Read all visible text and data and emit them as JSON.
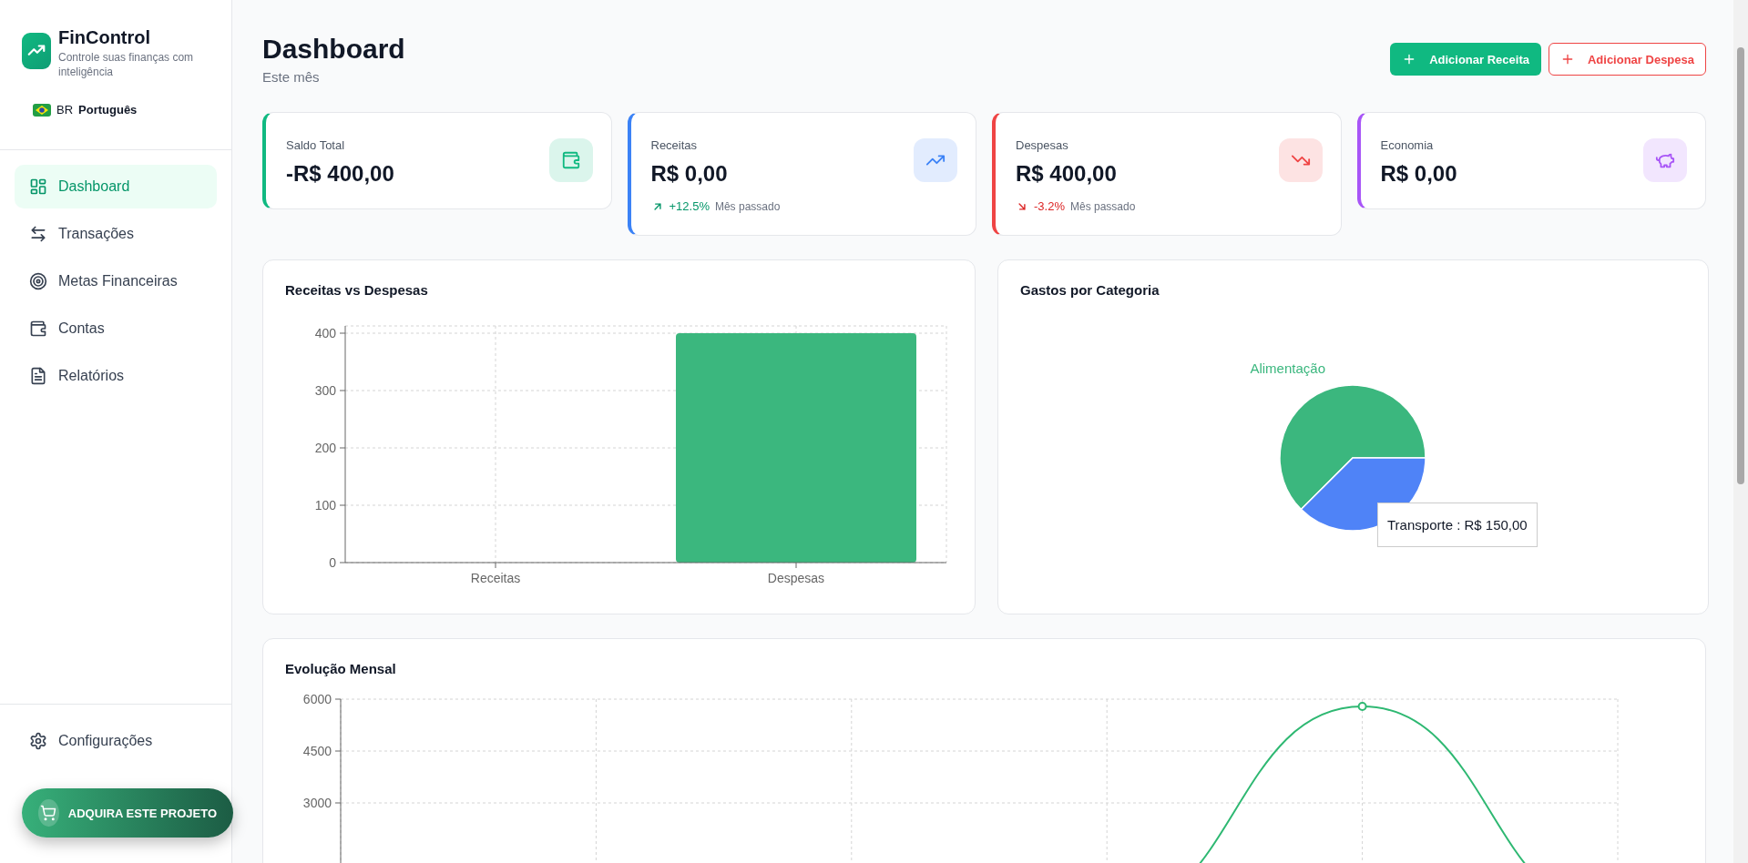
{
  "sidebar": {
    "brand": {
      "name": "FinControl",
      "tagline": "Controle suas finanças com inteligência"
    },
    "language": {
      "code": "BR",
      "label": "Português"
    },
    "nav": [
      {
        "label": "Dashboard",
        "selected": true
      },
      {
        "label": "Transações",
        "selected": false
      },
      {
        "label": "Metas Financeiras",
        "selected": false
      },
      {
        "label": "Contas",
        "selected": false
      },
      {
        "label": "Relatórios",
        "selected": false
      }
    ],
    "bottom_nav": [
      {
        "label": "Configurações",
        "selected": false
      }
    ]
  },
  "promo_button": "ADQUIRA ESTE PROJETO",
  "header": {
    "title": "Dashboard",
    "subtitle": "Este mês",
    "buttons": [
      {
        "label": "Adicionar Receita",
        "kind": "primary"
      },
      {
        "label": "Adicionar Despesa",
        "kind": "outline"
      }
    ]
  },
  "stats": [
    {
      "label": "Saldo Total",
      "value": "-R$ 400,00",
      "color": "#10b981"
    },
    {
      "label": "Receitas",
      "value": "R$ 0,00",
      "color": "#3b82f6",
      "trend": {
        "kind": "up",
        "change": "+12.5%",
        "note": "Mês passado"
      }
    },
    {
      "label": "Despesas",
      "value": "R$ 400,00",
      "color": "#ef4444",
      "trend": {
        "kind": "down",
        "change": "-3.2%",
        "note": "Mês passado"
      }
    },
    {
      "label": "Economia",
      "value": "R$ 0,00",
      "color": "#a855f7"
    }
  ],
  "income_vs_expense": {
    "title": "Receitas vs Despesas",
    "chart_data": {
      "type": "bar",
      "categories": [
        "Receitas",
        "Despesas"
      ],
      "values": [
        0,
        400
      ],
      "ylim": [
        0,
        400
      ],
      "yticks": [
        0,
        100,
        200,
        300,
        400
      ],
      "grid": true
    }
  },
  "spending_by_category": {
    "title": "Gastos por Categoria",
    "tooltip": {
      "separator": ":",
      "value": "R$ 150,00"
    },
    "chart_data": {
      "type": "pie",
      "categories": [
        "Alimentação",
        "Transporte"
      ],
      "values": [
        62.5,
        37.5
      ],
      "colors": [
        "#3bb77e",
        "#4f83f7"
      ]
    }
  },
  "monthly_evolution": {
    "title": "Evolução Mensal",
    "y_ticks": [
      "6000",
      "4500",
      "3000"
    ]
  }
}
